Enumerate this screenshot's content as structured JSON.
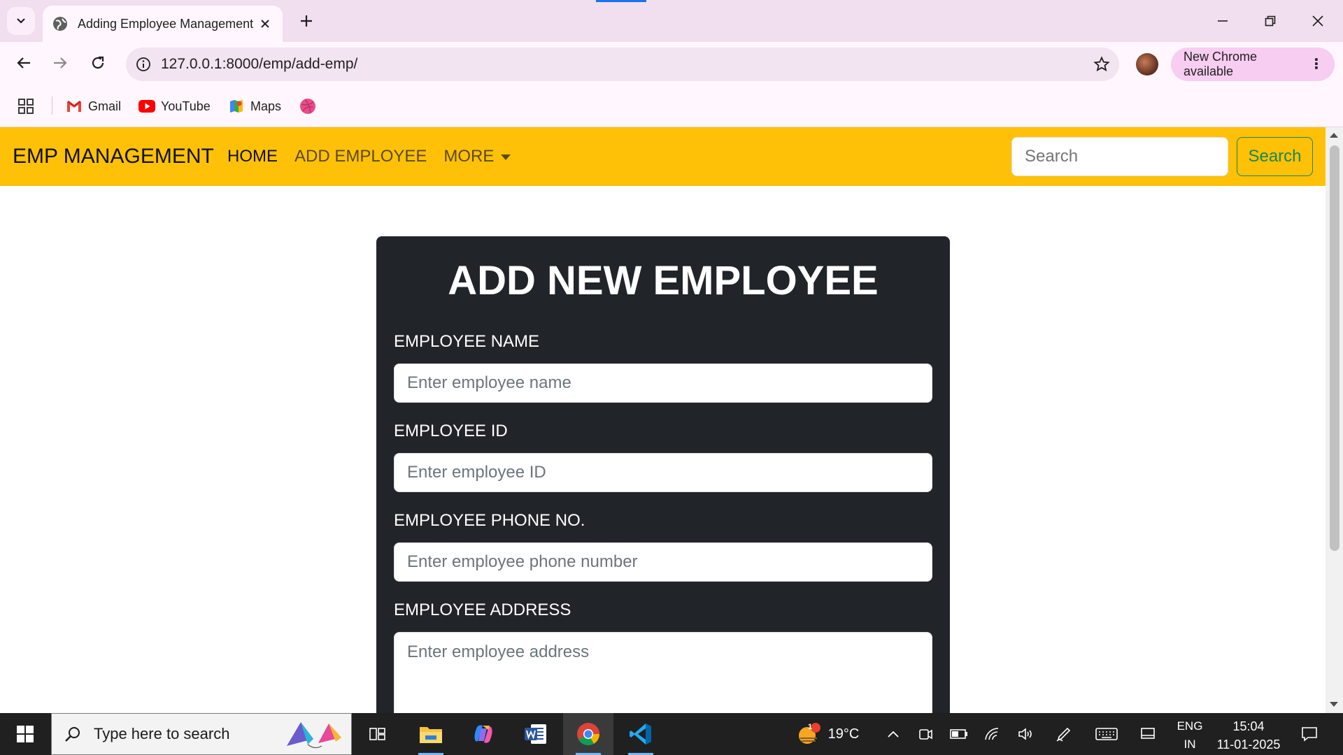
{
  "browser": {
    "tab_title": "Adding Employee Management",
    "url": "127.0.0.1:8000/emp/add-emp/",
    "update_label": "New Chrome available",
    "bookmarks": [
      {
        "label": "Gmail",
        "icon": "gmail-icon"
      },
      {
        "label": "YouTube",
        "icon": "youtube-icon"
      },
      {
        "label": "Maps",
        "icon": "maps-icon"
      },
      {
        "label": "",
        "icon": "dribbble-icon"
      }
    ]
  },
  "navbar": {
    "brand": "EMP MANAGEMENT",
    "links": [
      {
        "label": "HOME",
        "active": true
      },
      {
        "label": "ADD EMPLOYEE",
        "active": false
      },
      {
        "label": "MORE",
        "active": false,
        "dropdown": true
      }
    ],
    "search_placeholder": "Search",
    "search_button": "Search",
    "background_color": "#ffc107",
    "accent_color": "#198754"
  },
  "form": {
    "title": "ADD NEW EMPLOYEE",
    "fields": [
      {
        "label": "EMPLOYEE NAME",
        "placeholder": "Enter employee name",
        "type": "input"
      },
      {
        "label": "EMPLOYEE ID",
        "placeholder": "Enter employee ID",
        "type": "input"
      },
      {
        "label": "EMPLOYEE PHONE NO.",
        "placeholder": "Enter employee phone number",
        "type": "input"
      },
      {
        "label": "EMPLOYEE ADDRESS",
        "placeholder": "Enter employee address",
        "type": "textarea"
      }
    ],
    "card_color": "#212529"
  },
  "taskbar": {
    "search_placeholder": "Type here to search",
    "weather_temp": "19°C",
    "weather_badge": "1",
    "language_line1": "ENG",
    "language_line2": "IN",
    "time": "15:04",
    "date": "11-01-2025"
  }
}
